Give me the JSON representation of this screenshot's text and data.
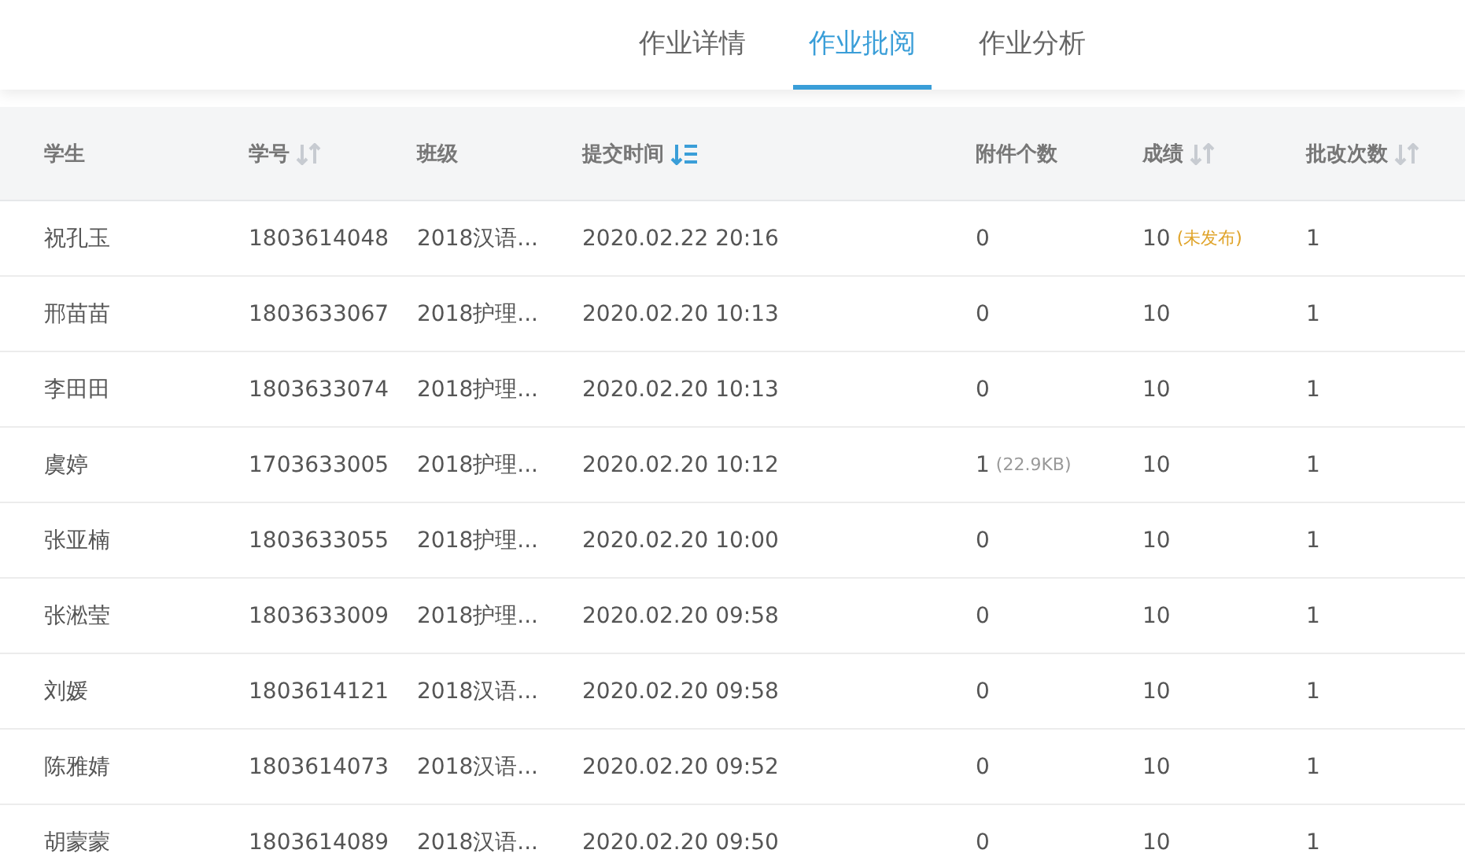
{
  "tabs": [
    {
      "label": "作业详情",
      "selected": false
    },
    {
      "label": "作业批阅",
      "selected": true
    },
    {
      "label": "作业分析",
      "selected": false
    }
  ],
  "table": {
    "columns": [
      {
        "label": "学生",
        "kind": "plain",
        "sorted": false
      },
      {
        "label": "学号",
        "kind": "sortable",
        "sorted": false
      },
      {
        "label": "班级",
        "kind": "plain",
        "sorted": false
      },
      {
        "label": "提交时间",
        "kind": "sortable",
        "sorted": true
      },
      {
        "label": "附件个数",
        "kind": "plain",
        "sorted": false
      },
      {
        "label": "成绩",
        "kind": "sortable",
        "sorted": false
      },
      {
        "label": "批改次数",
        "kind": "sortable",
        "sorted": false
      }
    ],
    "rows": [
      {
        "student": "祝孔玉",
        "id": "1803614048",
        "class": "2018汉语...",
        "time": "2020.02.22 20:16",
        "attachments": "0",
        "score": "10",
        "score_note": "(未发布)",
        "reviews": "1"
      },
      {
        "student": "邢苗苗",
        "id": "1803633067",
        "class": "2018护理...",
        "time": "2020.02.20 10:13",
        "attachments": "0",
        "score": "10",
        "reviews": "1"
      },
      {
        "student": "李田田",
        "id": "1803633074",
        "class": "2018护理...",
        "time": "2020.02.20 10:13",
        "attachments": "0",
        "score": "10",
        "reviews": "1"
      },
      {
        "student": "虞婷",
        "id": "1703633005",
        "class": "2018护理...",
        "time": "2020.02.20 10:12",
        "attachments": "1",
        "attachment_size": "(22.9KB)",
        "score": "10",
        "reviews": "1"
      },
      {
        "student": "张亚楠",
        "id": "1803633055",
        "class": "2018护理...",
        "time": "2020.02.20 10:00",
        "attachments": "0",
        "score": "10",
        "reviews": "1"
      },
      {
        "student": "张淞莹",
        "id": "1803633009",
        "class": "2018护理...",
        "time": "2020.02.20 09:58",
        "attachments": "0",
        "score": "10",
        "reviews": "1"
      },
      {
        "student": "刘媛",
        "id": "1803614121",
        "class": "2018汉语...",
        "time": "2020.02.20 09:58",
        "attachments": "0",
        "score": "10",
        "reviews": "1"
      },
      {
        "student": "陈雅婧",
        "id": "1803614073",
        "class": "2018汉语...",
        "time": "2020.02.20 09:52",
        "attachments": "0",
        "score": "10",
        "reviews": "1"
      },
      {
        "student": "胡蒙蒙",
        "id": "1803614089",
        "class": "2018汉语...",
        "time": "2020.02.20 09:50",
        "attachments": "0",
        "score": "10",
        "reviews": "1"
      }
    ]
  }
}
